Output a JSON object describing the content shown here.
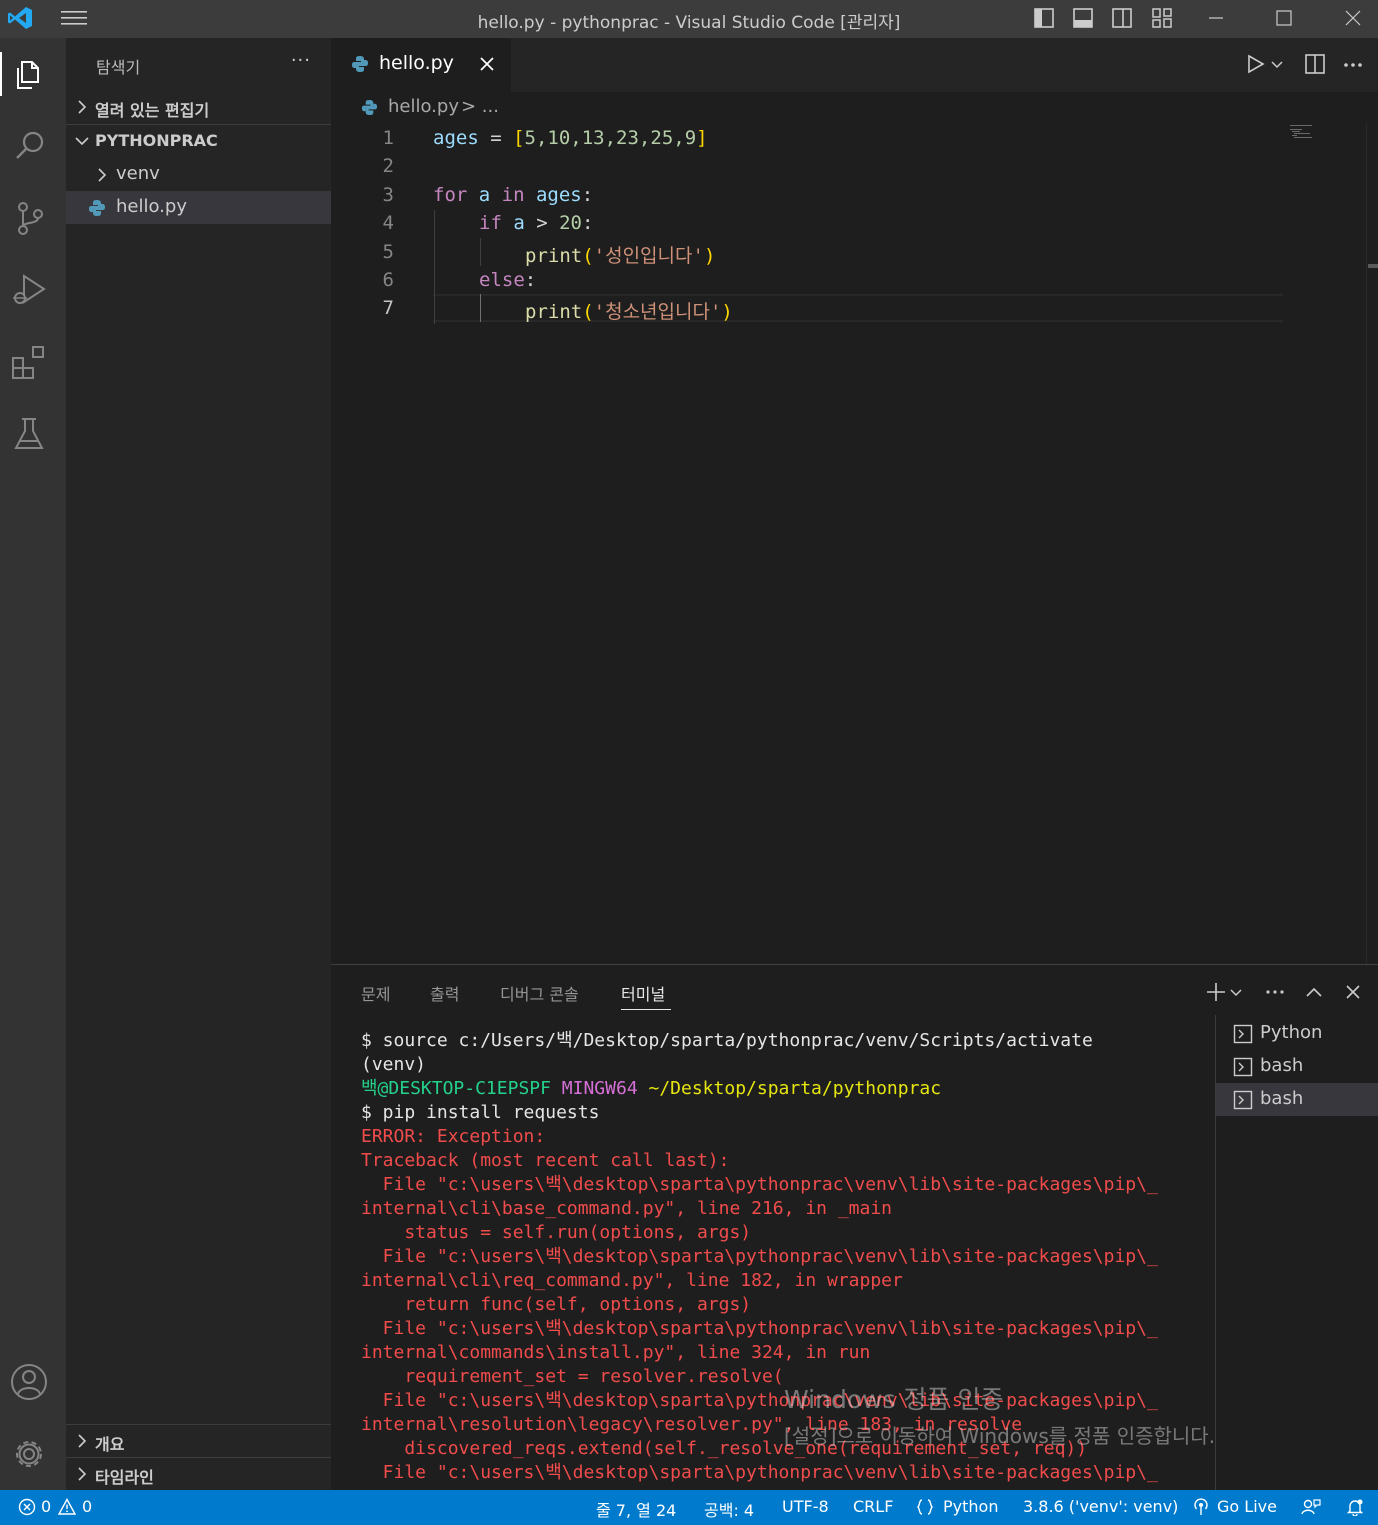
{
  "window": {
    "title": "hello.py - pythonprac - Visual Studio Code [관리자]"
  },
  "sidebar": {
    "title": "탐색기",
    "more": "···",
    "open_editors": "열려 있는 편집기",
    "folder": "PYTHONPRAC",
    "items": [
      {
        "label": "venv",
        "type": "folder"
      },
      {
        "label": "hello.py",
        "type": "file",
        "selected": true
      }
    ],
    "outline": "개요",
    "timeline": "타임라인"
  },
  "editor": {
    "tab_label": "hello.py",
    "breadcrumb_file": "hello.py",
    "breadcrumb_rest": "> ...",
    "line_numbers": [
      "1",
      "2",
      "3",
      "4",
      "5",
      "6",
      "7"
    ],
    "current_line": 7,
    "code": {
      "l1_var": "ages",
      "l1_op": " = ",
      "l1_open": "[",
      "l1_nums": "5,10,13,23,25,9",
      "l1_close": "]",
      "l3_for": "for",
      "l3_a": " a ",
      "l3_in": "in",
      "l3_ages": " ages",
      "l3_colon": ":",
      "l4_if": "if",
      "l4_a": " a ",
      "l4_gt": "> ",
      "l4_num": "20",
      "l4_colon": ":",
      "l5_fn": "print",
      "l5_open": "(",
      "l5_str": "'성인입니다'",
      "l5_close": ")",
      "l6_else": "else",
      "l6_colon": ":",
      "l7_fn": "print",
      "l7_open": "(",
      "l7_str": "'청소년입니다'",
      "l7_close": ")"
    }
  },
  "panel": {
    "tabs": [
      "문제",
      "출력",
      "디버그 콘솔",
      "터미널"
    ],
    "active_tab": "터미널",
    "terminal_lines": [
      {
        "parts": [
          {
            "t": "$ source c:/Users/백/Desktop/sparta/pythonprac/venv/Scripts/activate",
            "c": "w"
          }
        ]
      },
      {
        "parts": [
          {
            "t": "(venv)",
            "c": "w"
          }
        ]
      },
      {
        "parts": [
          {
            "t": "백@DESKTOP-C1EPSPF",
            "c": "g"
          },
          {
            "t": " ",
            "c": "w"
          },
          {
            "t": "MINGW64",
            "c": "m"
          },
          {
            "t": " ",
            "c": "w"
          },
          {
            "t": "~/Desktop/sparta/pythonprac",
            "c": "y"
          }
        ]
      },
      {
        "parts": [
          {
            "t": "$ pip install requests",
            "c": "w"
          }
        ]
      },
      {
        "parts": [
          {
            "t": "ERROR: Exception:",
            "c": "r"
          }
        ]
      },
      {
        "parts": [
          {
            "t": "Traceback (most recent call last):",
            "c": "r"
          }
        ]
      },
      {
        "parts": [
          {
            "t": "  File \"c:\\users\\백\\desktop\\sparta\\pythonprac\\venv\\lib\\site-packages\\pip\\_",
            "c": "r"
          }
        ]
      },
      {
        "parts": [
          {
            "t": "internal\\cli\\base_command.py\", line 216, in _main",
            "c": "r"
          }
        ]
      },
      {
        "parts": [
          {
            "t": "    status = self.run(options, args)",
            "c": "r"
          }
        ]
      },
      {
        "parts": [
          {
            "t": "  File \"c:\\users\\백\\desktop\\sparta\\pythonprac\\venv\\lib\\site-packages\\pip\\_",
            "c": "r"
          }
        ]
      },
      {
        "parts": [
          {
            "t": "internal\\cli\\req_command.py\", line 182, in wrapper",
            "c": "r"
          }
        ]
      },
      {
        "parts": [
          {
            "t": "    return func(self, options, args)",
            "c": "r"
          }
        ]
      },
      {
        "parts": [
          {
            "t": "  File \"c:\\users\\백\\desktop\\sparta\\pythonprac\\venv\\lib\\site-packages\\pip\\_",
            "c": "r"
          }
        ]
      },
      {
        "parts": [
          {
            "t": "internal\\commands\\install.py\", line 324, in run",
            "c": "r"
          }
        ]
      },
      {
        "parts": [
          {
            "t": "    requirement_set = resolver.resolve(",
            "c": "r"
          }
        ]
      },
      {
        "parts": [
          {
            "t": "  File \"c:\\users\\백\\desktop\\sparta\\pythonprac\\venv\\lib\\site-packages\\pip\\_",
            "c": "r"
          }
        ]
      },
      {
        "parts": [
          {
            "t": "internal\\resolution\\legacy\\resolver.py\", line 183, in resolve",
            "c": "r"
          }
        ]
      },
      {
        "parts": [
          {
            "t": "    discovered_reqs.extend(self._resolve_one(requirement_set, req))",
            "c": "r"
          }
        ]
      },
      {
        "parts": [
          {
            "t": "  File \"c:\\users\\백\\desktop\\sparta\\pythonprac\\venv\\lib\\site-packages\\pip\\_",
            "c": "r"
          }
        ]
      }
    ],
    "terminals": [
      {
        "label": "Python",
        "selected": false
      },
      {
        "label": "bash",
        "selected": false
      },
      {
        "label": "bash",
        "selected": true
      }
    ]
  },
  "watermark": {
    "title": "Windows 정품 인증",
    "subtitle": "[설정]으로 이동하여 Windows를 정품 인증합니다."
  },
  "statusbar": {
    "errors": "0",
    "warnings": "0",
    "position": "줄 7, 열 24",
    "spaces": "공백: 4",
    "encoding": "UTF-8",
    "eol": "CRLF",
    "language": "Python",
    "interpreter": "3.8.6 ('venv': venv)",
    "golive": "Go Live"
  },
  "colors": {
    "statusbar": "#007acc",
    "activitybar": "#333333",
    "sidebar": "#252526",
    "editor": "#1e1e1e",
    "error_text": "#f14c4c"
  },
  "icons": {
    "activity": [
      "explorer-icon",
      "search-icon",
      "source-control-icon",
      "run-debug-icon",
      "extensions-icon",
      "testing-icon",
      "account-icon",
      "settings-gear-icon"
    ]
  }
}
